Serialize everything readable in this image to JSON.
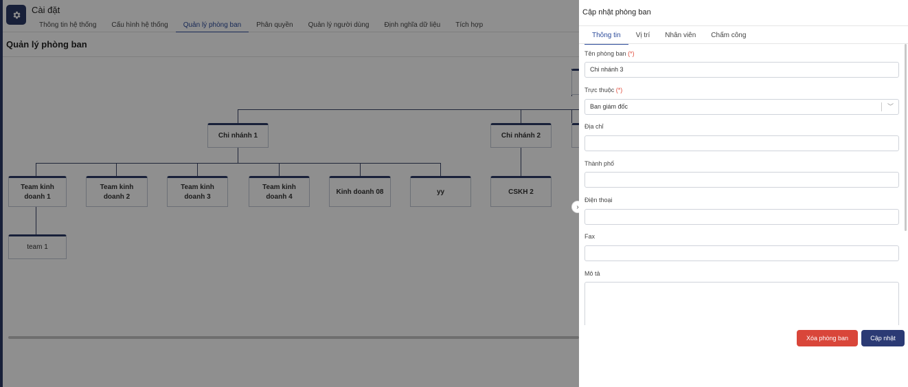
{
  "app": {
    "title": "Cài đặt",
    "icon": "gear-icon"
  },
  "topnav": {
    "tabs": [
      {
        "label": "Thông tin hệ thống"
      },
      {
        "label": "Cấu hình hệ thống"
      },
      {
        "label": "Quản lý phòng ban",
        "active": true
      },
      {
        "label": "Phân quyền"
      },
      {
        "label": "Quản lý người dùng"
      },
      {
        "label": "Định nghĩa dữ liệu"
      },
      {
        "label": "Tích hợp"
      }
    ]
  },
  "page": {
    "title": "Quản lý phòng ban"
  },
  "org_chart": {
    "nodes": [
      {
        "id": "cn1",
        "label": "Chi nhánh 1"
      },
      {
        "id": "cn2",
        "label": "Chi nhánh 2"
      },
      {
        "id": "tk1",
        "label": "Team kinh doanh 1"
      },
      {
        "id": "tk2",
        "label": "Team kinh doanh 2"
      },
      {
        "id": "tk3",
        "label": "Team kinh doanh 3"
      },
      {
        "id": "tk4",
        "label": "Team kinh doanh 4"
      },
      {
        "id": "kd08",
        "label": "Kinh doanh 08"
      },
      {
        "id": "yy",
        "label": "yy"
      },
      {
        "id": "cskh2",
        "label": "CSKH 2"
      },
      {
        "id": "team1",
        "label": "team 1"
      }
    ]
  },
  "panel": {
    "title": "Cập nhật phòng ban",
    "tabs": [
      {
        "label": "Thông tin",
        "active": true
      },
      {
        "label": "Vị trí"
      },
      {
        "label": "Nhân viên"
      },
      {
        "label": "Chấm công"
      }
    ],
    "required_marker": "(*)",
    "fields": {
      "name": {
        "label": "Tên phòng ban",
        "value": "Chi nhánh 3"
      },
      "parent": {
        "label": "Trực thuộc",
        "value": "Ban giám đốc"
      },
      "address": {
        "label": "Địa chỉ",
        "value": ""
      },
      "city": {
        "label": "Thành phố",
        "value": ""
      },
      "phone": {
        "label": "Điện thoại",
        "value": ""
      },
      "fax": {
        "label": "Fax",
        "value": ""
      },
      "description": {
        "label": "Mô tả",
        "value": ""
      }
    },
    "buttons": {
      "delete": "Xóa phòng ban",
      "update": "Cập nhật"
    },
    "colors": {
      "primary": "#2b3a74",
      "danger": "#d9463a"
    }
  }
}
